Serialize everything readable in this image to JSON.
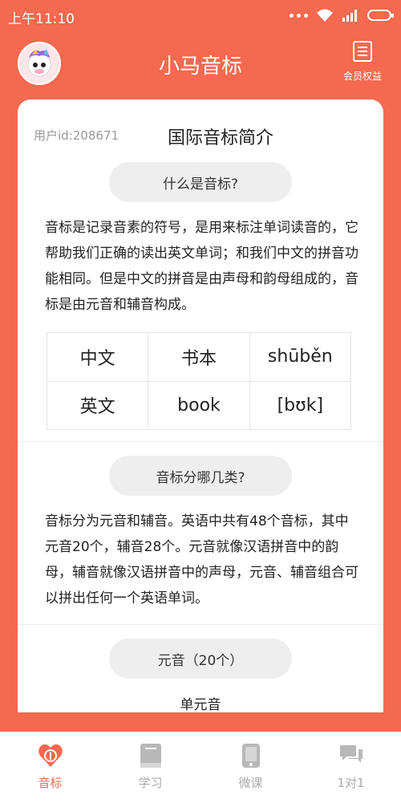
{
  "status": {
    "time": "上午11:10"
  },
  "header": {
    "title": "小马音标",
    "vip_label": "会员权益"
  },
  "card": {
    "user_id": "用户id:208671",
    "title": "国际音标简介",
    "section1": {
      "heading": "什么是音标?",
      "text": "音标是记录音素的符号，是用来标注单词读音的，它帮助我们正确的读出英文单词；和我们中文的拼音功能相同。但是中文的拼音是由声母和韵母组成的，音标是由元音和辅音构成。"
    },
    "table": [
      [
        "中文",
        "书本",
        "shūběn"
      ],
      [
        "英文",
        "book",
        "[bʊk]"
      ]
    ],
    "section2": {
      "heading": "音标分哪几类?",
      "text": "音标分为元音和辅音。英语中共有48个音标，其中元音20个，辅音28个。元音就像汉语拼音中的韵母，辅音就像汉语拼音中的声母，元音、辅音组合可以拼出任何一个英语单词。"
    },
    "section3": {
      "heading": "元音（20个）",
      "subheading": "单元音"
    }
  },
  "tabs": [
    {
      "label": "音标",
      "icon": "heart-a-icon",
      "active": true
    },
    {
      "label": "学习",
      "icon": "book-icon",
      "active": false
    },
    {
      "label": "微课",
      "icon": "tablet-icon",
      "active": false
    },
    {
      "label": "1对1",
      "icon": "chat-icon",
      "active": false
    }
  ],
  "colors": {
    "accent": "#f4694f",
    "pill": "#eeeeee",
    "inactive": "#aaaaaa"
  }
}
